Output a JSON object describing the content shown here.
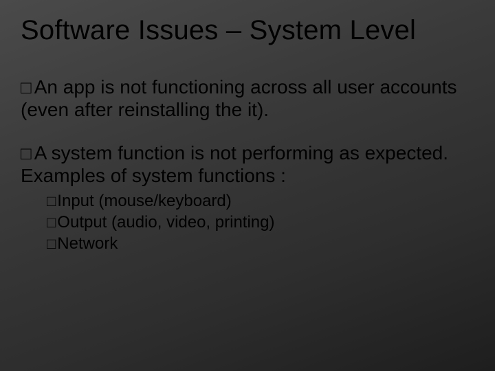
{
  "slide": {
    "title": "Software Issues – System Level",
    "bullets": [
      {
        "marker": "□",
        "text_a": "An",
        "text_b": " app is not functioning across all user accounts (even after reinstalling the it)."
      },
      {
        "marker": "□",
        "text_a": "A",
        "text_b": " system function is not performing as expected. Examples of system functions :",
        "sub": [
          {
            "marker": "□",
            "text": "Input (mouse/keyboard)"
          },
          {
            "marker": "□",
            "text": "Output (audio, video, printing)"
          },
          {
            "marker": "□",
            "text": "Network"
          }
        ]
      }
    ]
  }
}
